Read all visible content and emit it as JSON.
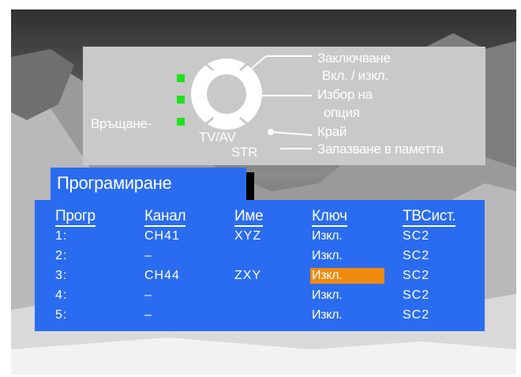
{
  "panel": {
    "return_label": "Връщане-",
    "source_label": "TV/AV",
    "store_key": "STR",
    "nav_up": "∧",
    "nav_down": "∨",
    "nav_minus": "−",
    "nav_plus": "+",
    "legend": {
      "lock_line1": "Заключване",
      "lock_line2": "Вкл. / изкл.",
      "option_line1": "Избор на",
      "option_line2": "опция",
      "exit": "Край",
      "store": "Запазване в паметта"
    },
    "led_color": "#1fe01f"
  },
  "menu": {
    "title": "Програмиране",
    "accent_color": "#2a6cf0",
    "highlight_color": "#f08a10",
    "headers": [
      "Прогр",
      "Канал",
      "Име",
      "Ключ",
      "ТВСист."
    ],
    "rows": [
      {
        "prog": "1:",
        "channel": "CH41",
        "name": "XYZ",
        "key": "Изкл.",
        "system": "SC2"
      },
      {
        "prog": "2:",
        "channel": "–",
        "name": "",
        "key": "Изкл.",
        "system": "SC2"
      },
      {
        "prog": "3:",
        "channel": "CH44",
        "name": "ZXY",
        "key": "Изкл.",
        "system": "SC2",
        "selected": true
      },
      {
        "prog": "4:",
        "channel": "–",
        "name": "",
        "key": "Изкл.",
        "system": "SC2"
      },
      {
        "prog": "5:",
        "channel": "–",
        "name": "",
        "key": "Изкл.",
        "system": "SC2"
      }
    ]
  }
}
